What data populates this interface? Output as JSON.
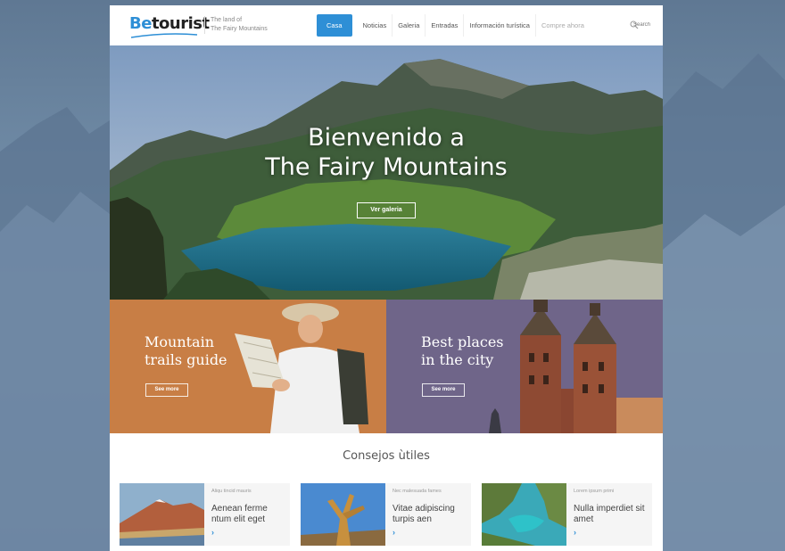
{
  "brand": {
    "logo_be": "Be",
    "logo_tourist": "tourist",
    "tagline_line1": "The land of",
    "tagline_line2": "The Fairy Mountains"
  },
  "nav": {
    "items": [
      {
        "label": "Casa"
      },
      {
        "label": "Noticias"
      },
      {
        "label": "Galeria"
      },
      {
        "label": "Entradas"
      },
      {
        "label": "Información turística"
      },
      {
        "label": "Compre ahora"
      }
    ],
    "search_placeholder": "Search"
  },
  "hero": {
    "title_line1": "Bienvenido a",
    "title_line2": "The Fairy Mountains",
    "button_label": "Ver galeria"
  },
  "promos": [
    {
      "title_line1": "Mountain",
      "title_line2": "trails guide",
      "button_label": "See more"
    },
    {
      "title_line1": "Best places",
      "title_line2": "in the city",
      "button_label": "See more"
    }
  ],
  "tips": {
    "heading": "Consejos ùtiles",
    "cards": [
      {
        "category": "Aliqu tincid mauris",
        "title": "Aenean ferme ntum elit eget",
        "arrow": "›"
      },
      {
        "category": "Nec malesuada fames",
        "title": "Vitae adipiscing turpis aen",
        "arrow": "›"
      },
      {
        "category": "Lorem ipsum primi",
        "title": "Nulla imperdiet sit amet",
        "arrow": "›"
      }
    ]
  },
  "colors": {
    "accent": "#2e8fd6",
    "promo_left": "#c87e45",
    "promo_right": "#6f6589"
  }
}
